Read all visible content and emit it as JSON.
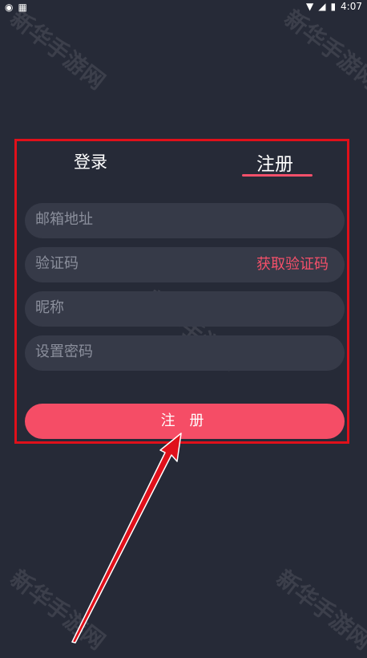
{
  "status_bar": {
    "time": "4:07"
  },
  "watermark": {
    "text": "新华手游网"
  },
  "tabs": {
    "login": "登录",
    "register": "注册"
  },
  "form": {
    "email_placeholder": "邮箱地址",
    "code_placeholder": "验证码",
    "get_code_label": "获取验证码",
    "nickname_placeholder": "昵称",
    "password_placeholder": "设置密码",
    "submit_label": "注 册"
  },
  "colors": {
    "background": "#262a37",
    "accent": "#f54d66",
    "annotation": "#e0101a"
  }
}
